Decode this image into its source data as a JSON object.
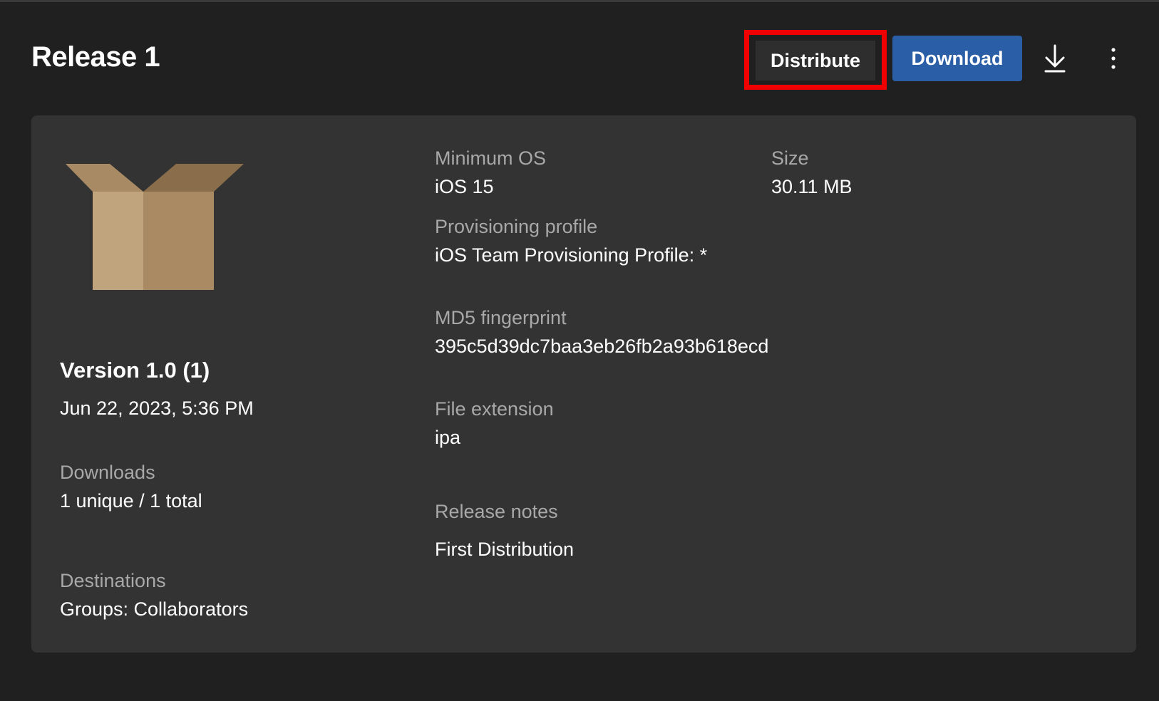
{
  "header": {
    "title": "Release 1",
    "distribute_label": "Distribute",
    "download_label": "Download",
    "download_icon": "download-arrow-icon",
    "more_icon": "more-vertical-icon"
  },
  "colors": {
    "background": "#202020",
    "card": "#333333",
    "primary_button": "#2a5ea6",
    "highlight_border": "#f00000",
    "label_text": "#a8a8a8"
  },
  "release": {
    "icon": "package-box-icon",
    "version": "Version 1.0 (1)",
    "date": "Jun 22, 2023, 5:36 PM",
    "downloads_label": "Downloads",
    "downloads_value": "1 unique / 1 total",
    "destinations_label": "Destinations",
    "destinations_value": "Groups: Collaborators"
  },
  "details": {
    "min_os_label": "Minimum OS",
    "min_os_value": "iOS 15",
    "size_label": "Size",
    "size_value": "30.11 MB",
    "provisioning_label": "Provisioning profile",
    "provisioning_value": "iOS Team Provisioning Profile: *",
    "md5_label": "MD5 fingerprint",
    "md5_value": "395c5d39dc7baa3eb26fb2a93b618ecd",
    "extension_label": "File extension",
    "extension_value": "ipa",
    "notes_label": "Release notes",
    "notes_value": "First Distribution"
  }
}
